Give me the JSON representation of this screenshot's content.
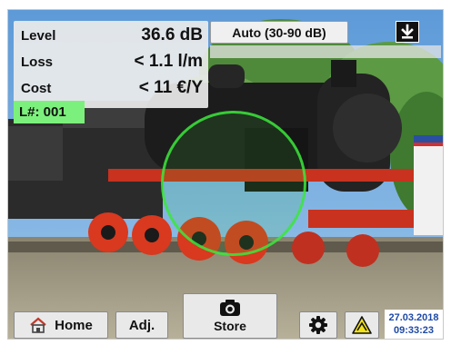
{
  "readout": {
    "level_label": "Level",
    "level_value": "36.6 dB",
    "loss_label": "Loss",
    "loss_value": "< 1.1 l/m",
    "cost_label": "Cost",
    "cost_value": "< 11 €/Y",
    "location_number": "L#: 001"
  },
  "range_selector": {
    "label": "Auto (30-90 dB)"
  },
  "toolbar": {
    "home_label": "Home",
    "adjust_label": "Adj.",
    "store_label": "Store",
    "settings_icon": "gear-icon",
    "warning_icon": "warning-triangle-icon",
    "camera_icon": "camera-icon",
    "download_icon": "download-icon"
  },
  "status": {
    "date": "27.03.2018",
    "time": "09:33:23"
  },
  "colors": {
    "location_badge": "#7cf07c",
    "focus_ring": "#3ce63c",
    "datetime_text": "#1d4aa6",
    "warning_fill": "#f2e21a"
  }
}
